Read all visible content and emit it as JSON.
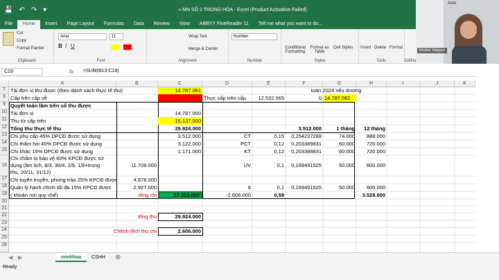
{
  "window": {
    "title": "« MN SỐ 2 TRONG HÓA - Excel (Product Activation Failed)"
  },
  "tabs": [
    "File",
    "Home",
    "Insert",
    "Page Layout",
    "Formulas",
    "Data",
    "Review",
    "View",
    "ABBYY FineReader 11"
  ],
  "tell_me": "Tell me what you want to do...",
  "ribbon": {
    "clipboard": {
      "cut": "Cut",
      "copy": "Copy",
      "format_painter": "Format Painter",
      "name": "Clipboard"
    },
    "font": {
      "face": "Arial",
      "size": "11",
      "name": "Font"
    },
    "alignment": {
      "wrap": "Wrap Text",
      "merge": "Merge & Center",
      "name": "Alignment"
    },
    "number": {
      "format": "Number",
      "name": "Number"
    },
    "styles": {
      "cond": "Conditional Formatting",
      "table": "Format as Table",
      "cell": "Cell Styles",
      "name": "Styles"
    },
    "cells": {
      "insert": "Insert",
      "delete": "Delete",
      "format": "Format",
      "name": "Cells"
    },
    "editing": {
      "auto": "Auto",
      "fill": "Fill",
      "clear": "Clea",
      "name": "Editing"
    }
  },
  "video": {
    "name": "Molter Haiyen"
  },
  "formula_bar": {
    "cell": "C19",
    "formula": "=SUM(B13:C18)"
  },
  "columns": [
    "A",
    "B",
    "C",
    "D",
    "E",
    "F",
    "G",
    "H",
    "I",
    "J",
    "K",
    "L"
  ],
  "rows": [
    "7",
    "8",
    "9",
    "10",
    "11",
    "12",
    "13",
    "14",
    "15",
    "16",
    "17",
    "18",
    "19",
    "20",
    "21",
    "22",
    "23",
    "24",
    "25",
    "26"
  ],
  "cells": {
    "a7": "Tái đơn vị thu được (theo danh sách thực tế thu)",
    "c7": "14.787.061",
    "f7": "toán 2024 nếu dương",
    "a8": "Cấp trên cấp về",
    "c8": "14.787.061",
    "d8": "Thực cấp trên cấp",
    "e8": "12.532.065",
    "f8": "0",
    "g8": "14.787.061",
    "a9": "Quyết toán lãm trên sổ thu được",
    "a10": "Tái đơn vị",
    "c10": "14.787.000",
    "a11": "Thu từ cấp trên",
    "c11": "15.137.000",
    "a12": "Tổng thu thực tế thu",
    "c12": "29.924.000",
    "f12": "3.512.000",
    "g12": "1 tháng",
    "h12": "12 tháng",
    "a13": "Chi phụ cấp 45% DPCĐ được sử dụng",
    "c13": "3.512.000",
    "d13": "CT",
    "e13": "0,15",
    "f13": "0,254237288",
    "g13": "74.000",
    "h13": "888.000",
    "a14": "Chi thăm hỏi 40% DPCĐ được sử dụng",
    "c14": "3.122.000",
    "d14": "PCT",
    "e14": "0,12",
    "f14": "0,203389831",
    "g14": "60.000",
    "h14": "720.000",
    "a15": "Chi khác 15% DPCĐ được sử dụng",
    "c15": "1.171.000",
    "d15": "KT",
    "e15": "0,12",
    "f15": "0,203389831",
    "g15": "60.000",
    "h15": "720.000",
    "a16a": "Chi chăm lo bảo vệ 60% KPCĐ được sử",
    "a16b": "dụng (âm lịch, 8/3, 30/4, 2/9, 1/6+trung",
    "a16c": "thu, 20/11, 31/12)",
    "b16": "11.708.000",
    "d16": "UV",
    "e16": "0,1",
    "f16": "0,169491525",
    "g16": "50.000",
    "h16": "600.000",
    "a17": "Chi tuyên truyền, phong trào 25% KPCĐ được",
    "b17": "4.878.000",
    "a18": "Quản lý hành chính tối đa 15% KPCD được",
    "b18": "2.927.000",
    "d18": "tt",
    "e18": "0,1",
    "f18": "0,169491525",
    "g18": "50.000",
    "h18": "600.000",
    "a19": "( khoản nơi quy chế)",
    "b19": "tổng chi",
    "c19": "27.318.000",
    "d19": "-2.606.000",
    "e19": "0,59",
    "h19": "3.528.000",
    "b22": "tổng thu",
    "c22": "29.924.000",
    "b24": "Chênh lệch thu chi",
    "c24": "2.606.000"
  },
  "sheets": [
    "minhhoa",
    "CSHH"
  ],
  "status": "Ready",
  "colors": {
    "yellow": "#ffff00",
    "red": "#ff0000",
    "green": "#00b050",
    "accent": "#217346"
  }
}
